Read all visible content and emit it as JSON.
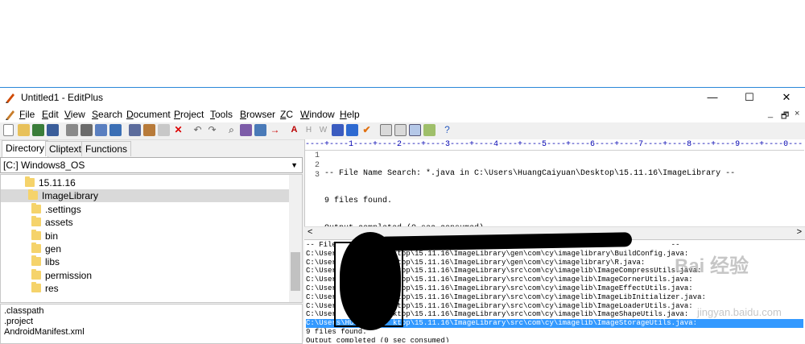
{
  "window": {
    "title": "Untitled1 - EditPlus",
    "controls": [
      "—",
      "☐",
      "✕"
    ]
  },
  "menu": {
    "items": [
      {
        "prefix": "",
        "accel": "F",
        "rest": "ile"
      },
      {
        "prefix": "",
        "accel": "E",
        "rest": "dit"
      },
      {
        "prefix": "",
        "accel": "V",
        "rest": "iew"
      },
      {
        "prefix": "",
        "accel": "S",
        "rest": "earch"
      },
      {
        "prefix": "",
        "accel": "D",
        "rest": "ocument"
      },
      {
        "prefix": "",
        "accel": "P",
        "rest": "roject"
      },
      {
        "prefix": "",
        "accel": "T",
        "rest": "ools"
      },
      {
        "prefix": "",
        "accel": "B",
        "rest": "rowser"
      },
      {
        "prefix": "",
        "accel": "Z",
        "rest": "C"
      },
      {
        "prefix": "",
        "accel": "W",
        "rest": "indow"
      },
      {
        "prefix": "",
        "accel": "H",
        "rest": "elp"
      }
    ],
    "mdi_controls": [
      "_",
      "🗗",
      "×"
    ]
  },
  "sidebar": {
    "tabs": [
      "Directory",
      "Cliptext",
      "Functions"
    ],
    "drive": "[C:] Windows8_OS",
    "tree": [
      {
        "label": "15.11.16",
        "selected": false
      },
      {
        "label": "ImageLibrary",
        "selected": true
      },
      {
        "label": ".settings",
        "selected": false
      },
      {
        "label": "assets",
        "selected": false
      },
      {
        "label": "bin",
        "selected": false
      },
      {
        "label": "gen",
        "selected": false
      },
      {
        "label": "libs",
        "selected": false
      },
      {
        "label": "permission",
        "selected": false
      },
      {
        "label": "res",
        "selected": false
      }
    ],
    "files": [
      ".classpath",
      ".project",
      "AndroidManifest.xml"
    ]
  },
  "editor": {
    "ruler": "----+----1----+----2----+----3----+----4----+----5----+----6----+----7----+----8----+----9----+----0---",
    "lines": [
      {
        "num": "1",
        "text": "-- File Name Search: *.java in C:\\Users\\HuangCaiyuan\\Desktop\\15.11.16\\ImageLibrary --"
      },
      {
        "num": "2",
        "text": "9 files found."
      },
      {
        "num": "3",
        "text": "Output completed (0 sec consumed)"
      }
    ]
  },
  "output": {
    "lines": [
      {
        "text": "-- File                                                                             --",
        "selected": false
      },
      {
        "text": "C:\\User             ktop\\15.11.16\\ImageLibrary\\gen\\com\\cy\\imagelibrary\\BuildConfig.java:",
        "selected": false
      },
      {
        "text": "C:\\User             ktop\\15.11.16\\ImageLibrary\\gen\\com\\cy\\imagelibrary\\R.java:",
        "selected": false
      },
      {
        "text": "C:\\User             ktop\\15.11.16\\ImageLibrary\\src\\com\\cy\\imagelib\\ImageCompressUtils.java:",
        "selected": false
      },
      {
        "text": "C:\\User             ktop\\15.11.16\\ImageLibrary\\src\\com\\cy\\imagelib\\ImageCornerUtils.java:",
        "selected": false
      },
      {
        "text": "C:\\User             ktop\\15.11.16\\ImageLibrary\\src\\com\\cy\\imagelib\\ImageEffectUtils.java:",
        "selected": false
      },
      {
        "text": "C:\\User             ktop\\15.11.16\\ImageLibrary\\src\\com\\cy\\imagelib\\ImageLibInitializer.java:",
        "selected": false
      },
      {
        "text": "C:\\User             ktop\\15.11.16\\ImageLibrary\\src\\com\\cy\\imagelib\\ImageLoaderUtils.java:",
        "selected": false
      },
      {
        "text": "C:\\User             ktop\\15.11.16\\ImageLibrary\\src\\com\\cy\\imagelib\\ImageShapeUtils.java:",
        "selected": false
      },
      {
        "text": "C:\\Users\\HU         ktop\\15.11.16\\ImageLibrary\\src\\com\\cy\\imagelib\\ImageStorageUtils.java:",
        "selected": true
      },
      {
        "text": "9 files found.",
        "selected": false
      },
      {
        "text": "Output completed (0 sec consumed)",
        "selected": false
      }
    ]
  },
  "watermark": {
    "main": "Bai 经验",
    "sub": "jingyan.baidu.com"
  },
  "colors": {
    "accent": "#2b88d8",
    "selection": "#3399ff",
    "folder": "#f5d36b",
    "ruler": "#0000b0"
  }
}
